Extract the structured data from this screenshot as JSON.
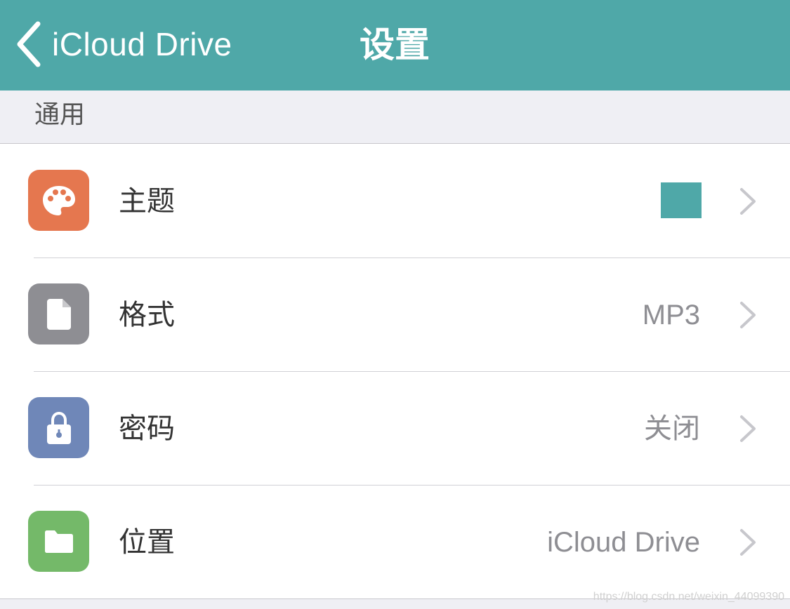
{
  "navbar": {
    "back_label": "iCloud Drive",
    "title": "设置",
    "background_color": "#4fa8a8"
  },
  "section": {
    "title": "通用"
  },
  "rows": [
    {
      "label": "主题",
      "value": "",
      "icon": "palette-icon",
      "icon_color": "#e5774f",
      "swatch_color": "#4fa8a8"
    },
    {
      "label": "格式",
      "value": "MP3",
      "icon": "document-icon",
      "icon_color": "#8e8e93"
    },
    {
      "label": "密码",
      "value": "关闭",
      "icon": "lock-icon",
      "icon_color": "#6f87b8"
    },
    {
      "label": "位置",
      "value": "iCloud Drive",
      "icon": "folder-icon",
      "icon_color": "#74b969"
    }
  ],
  "watermark": "https://blog.csdn.net/weixin_44099390"
}
